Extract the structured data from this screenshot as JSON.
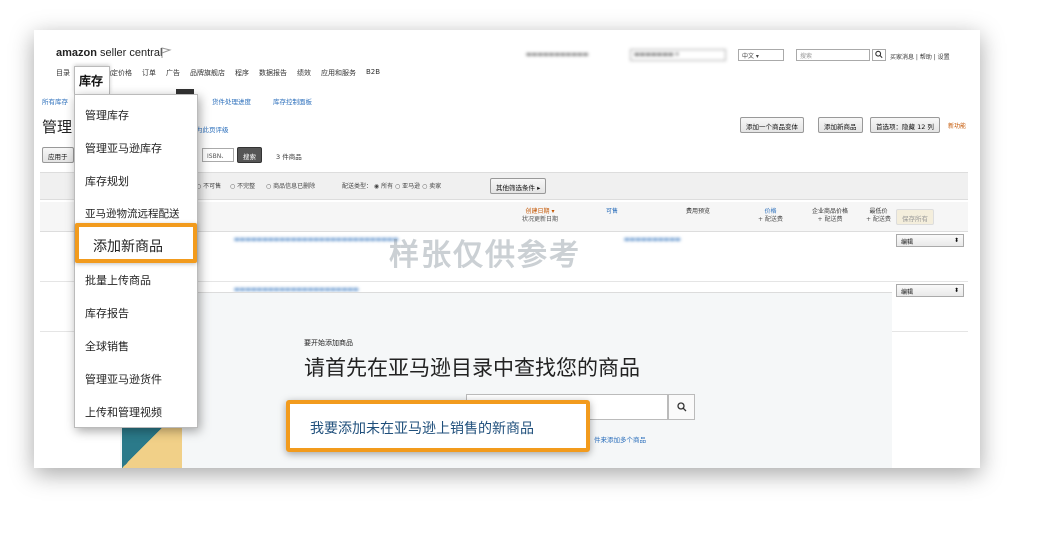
{
  "header": {
    "logo_bold": "amazon",
    "logo_rest": " seller central",
    "language": "中文",
    "search_placeholder": "搜索",
    "links": "买家消息 | 帮助 | 设置"
  },
  "nav": {
    "items": [
      "目录",
      "库存",
      "确定价格",
      "订单",
      "广告",
      "品牌旗舰店",
      "程序",
      "数据报告",
      "绩效",
      "应用和服务",
      "B2B"
    ],
    "active": "库存"
  },
  "breadcrumb": {
    "first": "所有库存",
    "items": [
      "货件处理进度",
      "库存控制面板"
    ]
  },
  "page": {
    "title": "管理",
    "sublink": "为此页评级",
    "apply_button": "应用于",
    "search_hint": "ISBN、",
    "search_button": "搜索",
    "count": "3 件商品",
    "buttons": {
      "variant": "添加一个商品变体",
      "add_new": "添加新商品",
      "prefs": "首选项：隐藏 12 列",
      "new_label": "新功能"
    }
  },
  "filters": {
    "status_options": [
      "不可售",
      "不完整",
      "商品信息已删除"
    ],
    "fulfillment_label": "配送类型：",
    "fulfillment_options": [
      "所有",
      "亚马逊",
      "卖家"
    ],
    "more_button": "其他筛选条件"
  },
  "table": {
    "headers": {
      "created": "创建日期",
      "status_updated": "状况更新日期",
      "available": "可售",
      "fee_preview": "费用预览",
      "price": "价格",
      "price_sub": "+ 配送费",
      "biz_price": "企业商品价格",
      "biz_sub": "+ 配送费",
      "min_price": "最低价",
      "min_sub": "+ 配送费",
      "save_all": "保存所有"
    },
    "rows": [
      {
        "edit": "编辑"
      },
      {
        "edit": "编辑"
      }
    ]
  },
  "watermark": "样张仅供参考",
  "panel": {
    "small_title": "要开始添加商品",
    "large_title": "请首先在亚马逊目录中查找您的商品",
    "bulk_link": "件来添加多个商品",
    "callout": "我要添加未在亚马逊上销售的新商品"
  },
  "dropdown": {
    "tab_label": "库存",
    "items": [
      "管理库存",
      "管理亚马逊库存",
      "库存规划",
      "亚马逊物流远程配送",
      "添加新商品",
      "批量上传商品",
      "库存报告",
      "全球销售",
      "管理亚马逊货件",
      "上传和管理视频"
    ],
    "highlighted": "添加新商品"
  },
  "colors": {
    "highlight": "#f29b1d",
    "link": "#2a6ebb",
    "callout_text": "#1f4f7b"
  }
}
